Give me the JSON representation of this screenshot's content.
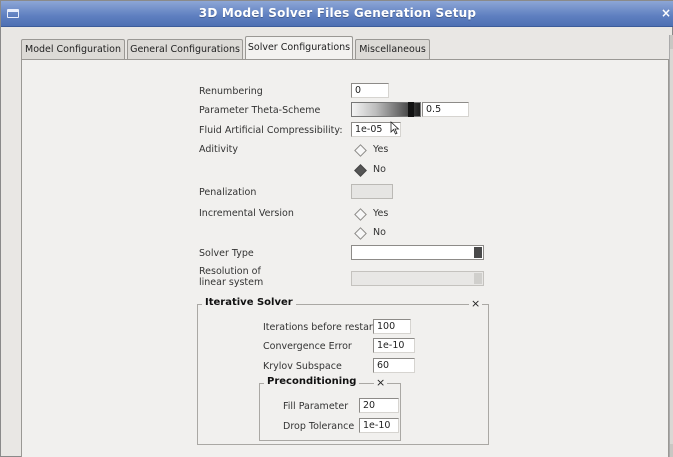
{
  "window": {
    "title": "3D Model Solver Files Generation Setup"
  },
  "tabs": [
    "Model Configuration",
    "General Configurations",
    "Solver Configurations",
    "Miscellaneous"
  ],
  "active_tab": "Solver Configurations",
  "form": {
    "renumbering": {
      "label": "Renumbering",
      "value": "0"
    },
    "theta": {
      "label": "Parameter Theta-Scheme",
      "value": "0.5",
      "level": 0.5
    },
    "compressibility": {
      "label": "Fluid Artificial Compressibility:",
      "value": "1e-05"
    },
    "aditivity": {
      "label": "Aditivity",
      "options": [
        "Yes",
        "No"
      ],
      "selected": "No"
    },
    "penalization": {
      "label": "Penalization",
      "value": ""
    },
    "incremental": {
      "label": "Incremental Version",
      "options": [
        "Yes",
        "No"
      ],
      "selected": "none"
    },
    "solver_type": {
      "label": "Solver Type",
      "value": ""
    },
    "resolution": {
      "label_line1": "Resolution of",
      "label_line2": "linear system",
      "value": ""
    }
  },
  "iterative": {
    "title": "Iterative Solver",
    "close": "×",
    "iterations": {
      "label": "Iterations before restart",
      "value": "100"
    },
    "convergence": {
      "label": "Convergence Error",
      "value": "1e-10"
    },
    "krylov": {
      "label": "Krylov Subspace",
      "value": "60"
    }
  },
  "preconditioning": {
    "title": "Preconditioning",
    "close": "×",
    "fill": {
      "label": "Fill Parameter",
      "value": "20"
    },
    "drop": {
      "label": "Drop Tolerance",
      "value": "1e-10"
    }
  },
  "colors": {
    "titlebar": "#5e7fc0",
    "panel": "#f1f0ee",
    "window": "#e9e7e4"
  }
}
